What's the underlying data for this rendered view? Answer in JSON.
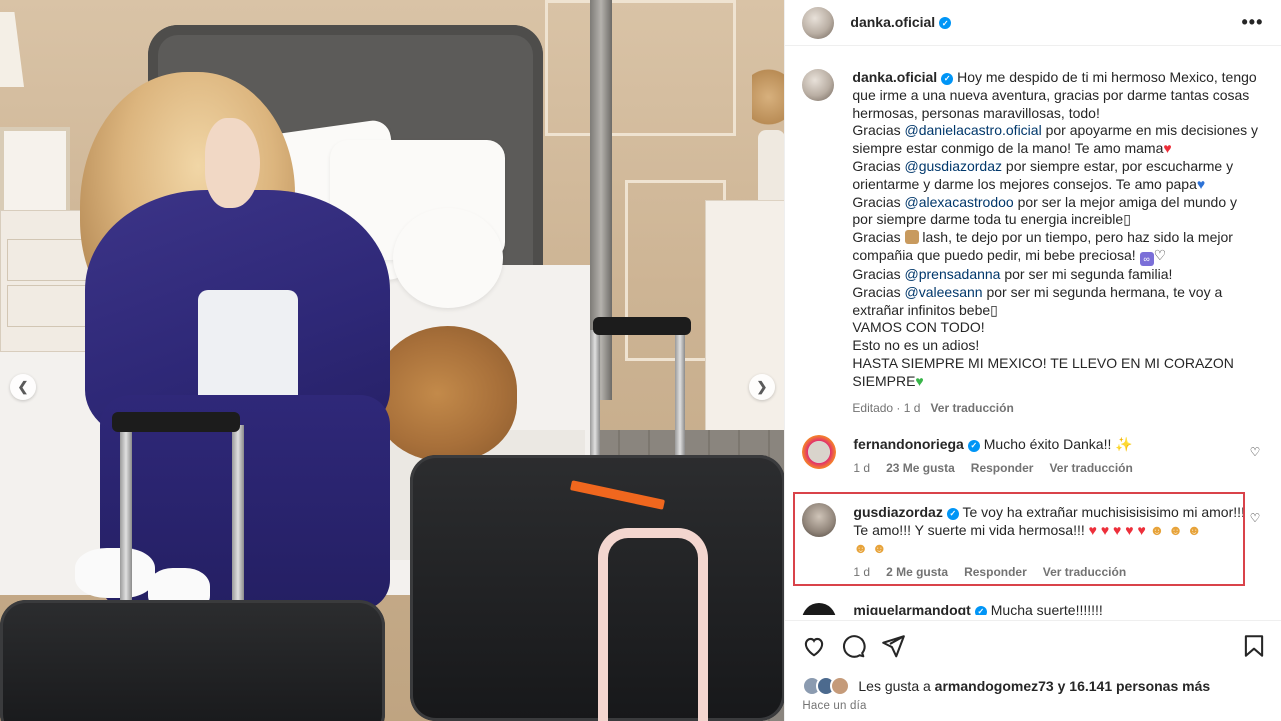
{
  "post": {
    "username": "danka.oficial",
    "more_icon": "more-options-icon",
    "caption": {
      "username": "danka.oficial",
      "l1": " Hoy me despido de ti mi hermoso Mexico, tengo",
      "l2": "que irme a una nueva aventura, gracias por darme tantas cosas",
      "l3": "hermosas, personas maravillosas, todo!",
      "l4_pre": "Gracias ",
      "l4_mention": "@danielacastro.oficial",
      "l4_post": " por apoyarme en mis decisiones y",
      "l5": "siempre estar conmigo de la mano! Te amo mama",
      "l6_pre": "Gracias ",
      "l6_mention": "@gusdiazordaz",
      "l6_post": " por siempre estar, por escucharme y",
      "l7": "orientarme y darme los mejores consejos. Te amo papa",
      "l8_pre": "Gracias ",
      "l8_mention": "@alexacastrodoo",
      "l8_post": " por ser la mejor amiga del mundo y",
      "l9": "por siempre darme toda tu energia increible",
      "l10_pre": "Gracias ",
      "l10_post": " lash, te dejo por un tiempo, pero haz sido la mejor",
      "l11": "compañia que puedo pedir, mi bebe preciosa!",
      "l12_pre": "Gracias ",
      "l12_mention": "@prensadanna",
      "l12_post": " por ser mi segunda familia!",
      "l13_pre": "Gracias ",
      "l13_mention": "@valeesann",
      "l13_post": " por ser mi segunda hermana, te voy a",
      "l14": "extrañar infinitos bebe",
      "l15": "VAMOS CON TODO!",
      "l16": "Esto no es un adios!",
      "l17": "HASTA SIEMPRE MI MEXICO! TE LLEVO EN MI CORAZON",
      "l18": "SIEMPRE",
      "edited": "Editado · 1 d",
      "translate": "Ver traducción"
    },
    "comments": [
      {
        "username": "fernandonoriega",
        "text": " Mucho éxito Danka!! ",
        "time": "1 d",
        "likes": "23 Me gusta",
        "reply": "Responder",
        "translate": "Ver traducción"
      },
      {
        "username": "gusdiazordaz",
        "text1": " Te voy ha extrañar muchisisisisimo mi amor!!!",
        "text2": "Te amo!!! Y suerte mi vida hermosa!!!",
        "time": "1 d",
        "likes": "2 Me gusta",
        "reply": "Responder",
        "translate": "Ver traducción"
      },
      {
        "username": "miguelarmandogt",
        "text": " Mucha suerte!!!!!!!"
      }
    ],
    "likes_text_pre": "Les gusta a ",
    "likes_user": "armandogomez73",
    "likes_text_post": " y 16.141 personas más",
    "time_ago": "Hace un día"
  },
  "colors": {
    "accent": "#0095f6",
    "link": "#00376b",
    "highlight": "#d9434a",
    "heart": "#ed2f3a"
  }
}
